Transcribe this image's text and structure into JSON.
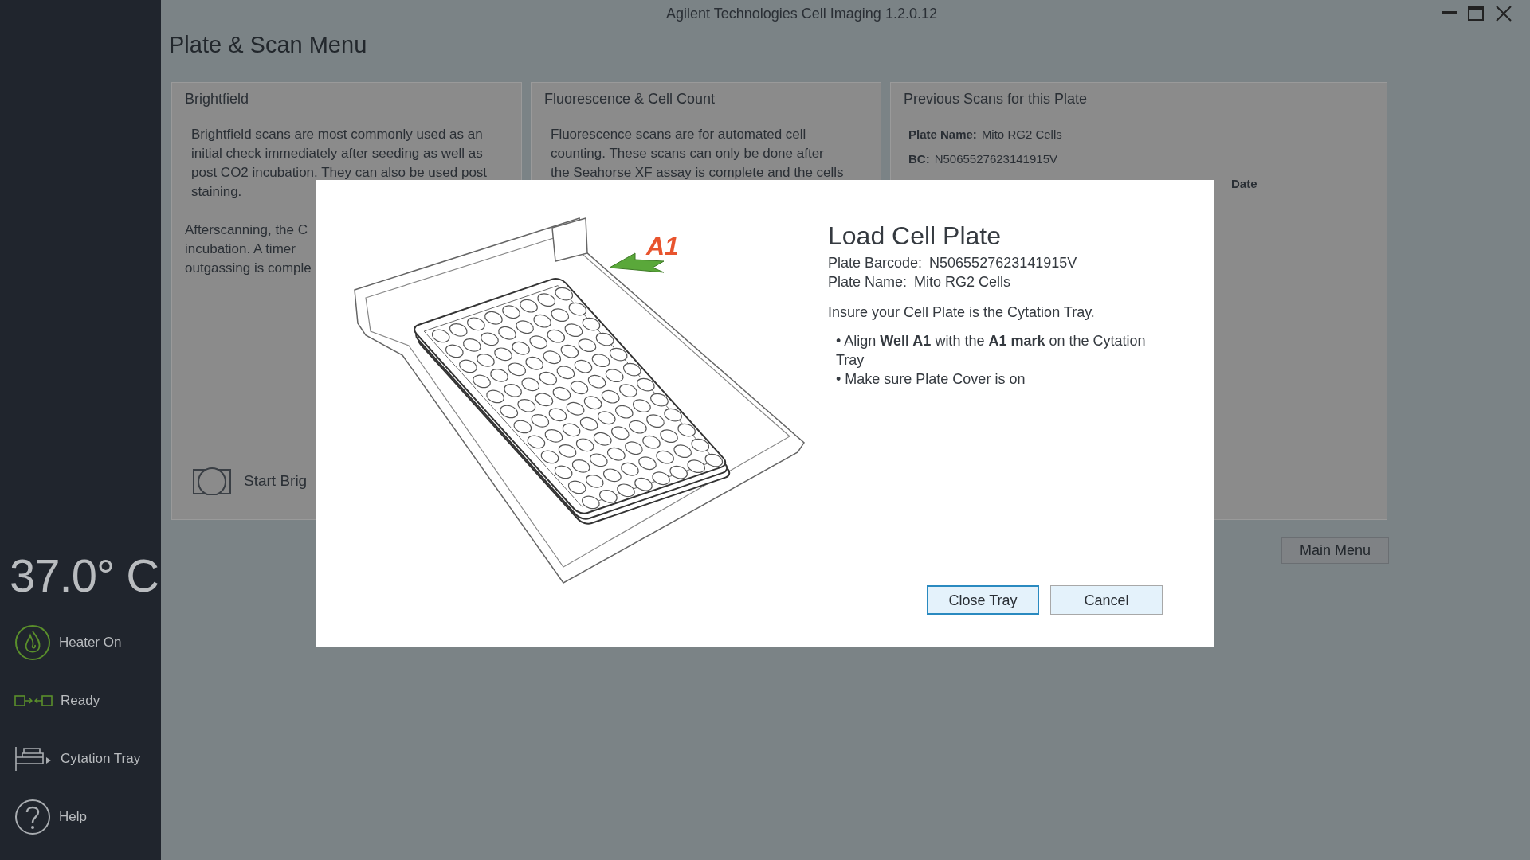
{
  "window": {
    "title": "Agilent Technologies Cell Imaging 1.2.0.12"
  },
  "page_title": "Plate & Scan Menu",
  "sidebar": {
    "temperature": "37.0° C",
    "items": [
      {
        "kind": "heater",
        "label": "Heater On"
      },
      {
        "kind": "ready",
        "label": "Ready"
      },
      {
        "kind": "tray",
        "label": "Cytation Tray"
      },
      {
        "kind": "help",
        "label": "Help"
      }
    ]
  },
  "panels": [
    {
      "kind": "brightfield",
      "title": "Brightfield",
      "paragraphs": [
        [
          "Brightfield scans are most commonly used as an",
          "initial check immediately after seeding as well as",
          "post CO2 incubation. They can also be used post",
          "staining."
        ],
        [
          "Afterscanning, the C",
          "incubation. A timer",
          "outgassing is comple"
        ]
      ],
      "start_button": "Start Brig"
    },
    {
      "kind": "fluorescence",
      "title": "Fluorescence & Cell Count",
      "paragraphs": [
        [
          "Fluorescence scans are for automated cell",
          "counting. These scans can only be done after",
          "the Seahorse XF assay is complete and the cells"
        ]
      ]
    },
    {
      "kind": "previous",
      "title": "Previous Scans for this Plate",
      "fields": [
        {
          "label": "Plate Name:",
          "value": "Mito RG2 Cells"
        },
        {
          "label": "BC:",
          "value": "N5065527623141915V"
        }
      ],
      "column_header": "Date"
    }
  ],
  "main_menu_button": "Main Menu",
  "dialog": {
    "title": "Load Cell Plate",
    "tray_mark_label": "A1",
    "details": [
      {
        "label": "Plate Barcode:",
        "value": "N5065527623141915V"
      },
      {
        "label": "Plate Name:",
        "value": "Mito RG2 Cells"
      }
    ],
    "instruction": "Insure your Cell Plate is the Cytation Tray.",
    "bullets": [
      "• Align **Well A1** with the **A1 mark** on the Cytation Tray",
      "• Make sure Plate Cover is on"
    ],
    "buttons": [
      {
        "label": "Close Tray",
        "selected": true
      },
      {
        "label": "Cancel",
        "selected": false
      }
    ]
  }
}
